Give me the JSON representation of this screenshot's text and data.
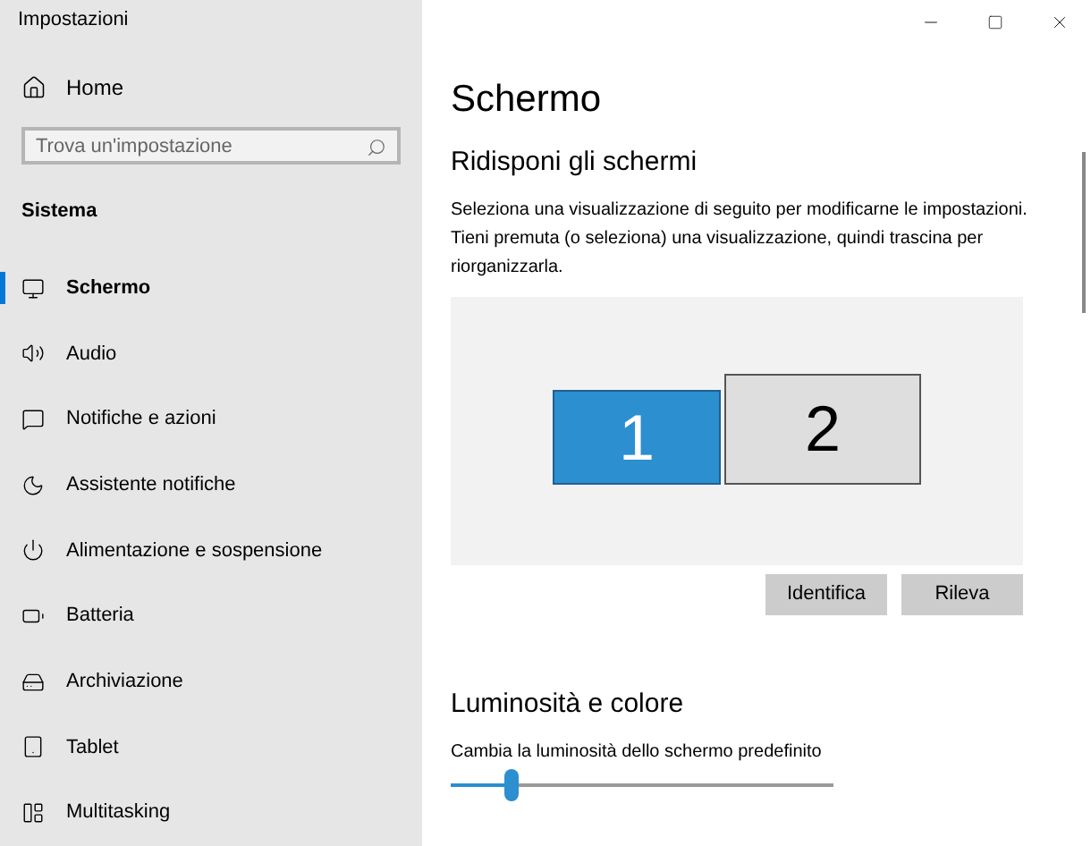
{
  "window": {
    "title": "Impostazioni"
  },
  "sidebar": {
    "home": "Home",
    "search": {
      "placeholder": "Trova un'impostazione"
    },
    "section": "Sistema",
    "items": [
      {
        "label": "Schermo",
        "selected": true
      },
      {
        "label": "Audio",
        "selected": false
      },
      {
        "label": "Notifiche e azioni",
        "selected": false
      },
      {
        "label": "Assistente notifiche",
        "selected": false
      },
      {
        "label": "Alimentazione e sospensione",
        "selected": false
      },
      {
        "label": "Batteria",
        "selected": false
      },
      {
        "label": "Archiviazione",
        "selected": false
      },
      {
        "label": "Tablet",
        "selected": false
      },
      {
        "label": "Multitasking",
        "selected": false
      }
    ]
  },
  "page": {
    "title": "Schermo",
    "arrange": {
      "heading": "Ridisponi gli schermi",
      "description": "Seleziona una visualizzazione di seguito per modificarne le impostazioni. Tieni premuta (o seleziona) una visualizzazione, quindi trascina per riorganizzarla.",
      "displays": [
        {
          "label": "1",
          "selected": true
        },
        {
          "label": "2",
          "selected": false
        }
      ],
      "buttons": [
        "Identifica",
        "Rileva"
      ]
    },
    "brightness": {
      "heading": "Luminosità e colore",
      "label": "Cambia la luminosità dello schermo predefinito",
      "level": 0.16
    }
  }
}
